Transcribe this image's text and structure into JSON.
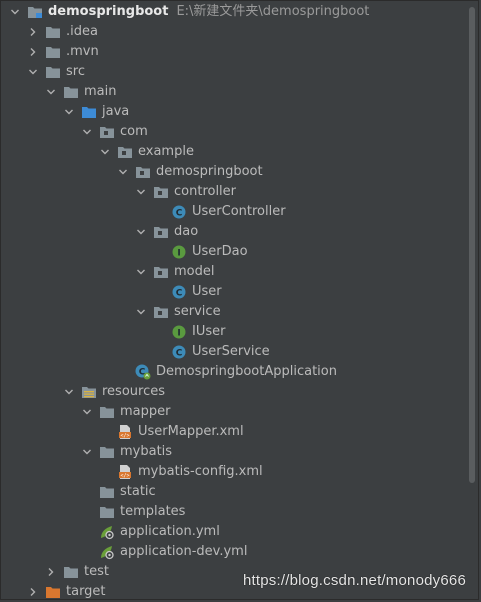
{
  "tree": [
    {
      "depth": 0,
      "arrow": "down",
      "icon": "module-folder-icon",
      "label": "demospringboot",
      "path": "E:\\新建文件夹\\demospringboot",
      "root": true
    },
    {
      "depth": 1,
      "arrow": "right",
      "icon": "folder-icon",
      "label": ".idea"
    },
    {
      "depth": 1,
      "arrow": "right",
      "icon": "folder-icon",
      "label": ".mvn"
    },
    {
      "depth": 1,
      "arrow": "down",
      "icon": "folder-icon",
      "label": "src"
    },
    {
      "depth": 2,
      "arrow": "down",
      "icon": "folder-icon",
      "label": "main"
    },
    {
      "depth": 3,
      "arrow": "down",
      "icon": "source-folder-icon",
      "label": "java"
    },
    {
      "depth": 4,
      "arrow": "down",
      "icon": "package-icon",
      "label": "com"
    },
    {
      "depth": 5,
      "arrow": "down",
      "icon": "package-icon",
      "label": "example"
    },
    {
      "depth": 6,
      "arrow": "down",
      "icon": "package-icon",
      "label": "demospringboot"
    },
    {
      "depth": 7,
      "arrow": "down",
      "icon": "package-icon",
      "label": "controller"
    },
    {
      "depth": 8,
      "arrow": "none",
      "icon": "class-icon",
      "label": "UserController"
    },
    {
      "depth": 7,
      "arrow": "down",
      "icon": "package-icon",
      "label": "dao"
    },
    {
      "depth": 8,
      "arrow": "none",
      "icon": "interface-icon",
      "label": "UserDao"
    },
    {
      "depth": 7,
      "arrow": "down",
      "icon": "package-icon",
      "label": "model"
    },
    {
      "depth": 8,
      "arrow": "none",
      "icon": "class-icon",
      "label": "User"
    },
    {
      "depth": 7,
      "arrow": "down",
      "icon": "package-icon",
      "label": "service"
    },
    {
      "depth": 8,
      "arrow": "none",
      "icon": "interface-icon",
      "label": "IUser"
    },
    {
      "depth": 8,
      "arrow": "none",
      "icon": "class-icon",
      "label": "UserService"
    },
    {
      "depth": 6,
      "arrow": "none",
      "icon": "spring-boot-class-icon",
      "label": "DemospringbootApplication"
    },
    {
      "depth": 3,
      "arrow": "down",
      "icon": "resources-folder-icon",
      "label": "resources"
    },
    {
      "depth": 4,
      "arrow": "down",
      "icon": "folder-icon",
      "label": "mapper"
    },
    {
      "depth": 5,
      "arrow": "none",
      "icon": "xml-file-icon",
      "label": "UserMapper.xml"
    },
    {
      "depth": 4,
      "arrow": "down",
      "icon": "folder-icon",
      "label": "mybatis"
    },
    {
      "depth": 5,
      "arrow": "none",
      "icon": "xml-file-icon",
      "label": "mybatis-config.xml"
    },
    {
      "depth": 4,
      "arrow": "none",
      "icon": "folder-icon",
      "label": "static"
    },
    {
      "depth": 4,
      "arrow": "none",
      "icon": "folder-icon",
      "label": "templates"
    },
    {
      "depth": 4,
      "arrow": "none",
      "icon": "yaml-config-icon",
      "label": "application.yml"
    },
    {
      "depth": 4,
      "arrow": "none",
      "icon": "yaml-config-icon",
      "label": "application-dev.yml"
    },
    {
      "depth": 2,
      "arrow": "right",
      "icon": "folder-icon",
      "label": "test"
    },
    {
      "depth": 1,
      "arrow": "right",
      "icon": "excluded-folder-icon",
      "label": "target"
    }
  ],
  "watermark": "https://blog.csdn.net/monody666",
  "colors": {
    "background": "#3c3f41",
    "text": "#bbbbbb",
    "folder": "#87939a",
    "source_folder": "#3d8bd6",
    "class": "#3d8bb8",
    "interface": "#5a9a3f",
    "excluded": "#d9772f"
  }
}
